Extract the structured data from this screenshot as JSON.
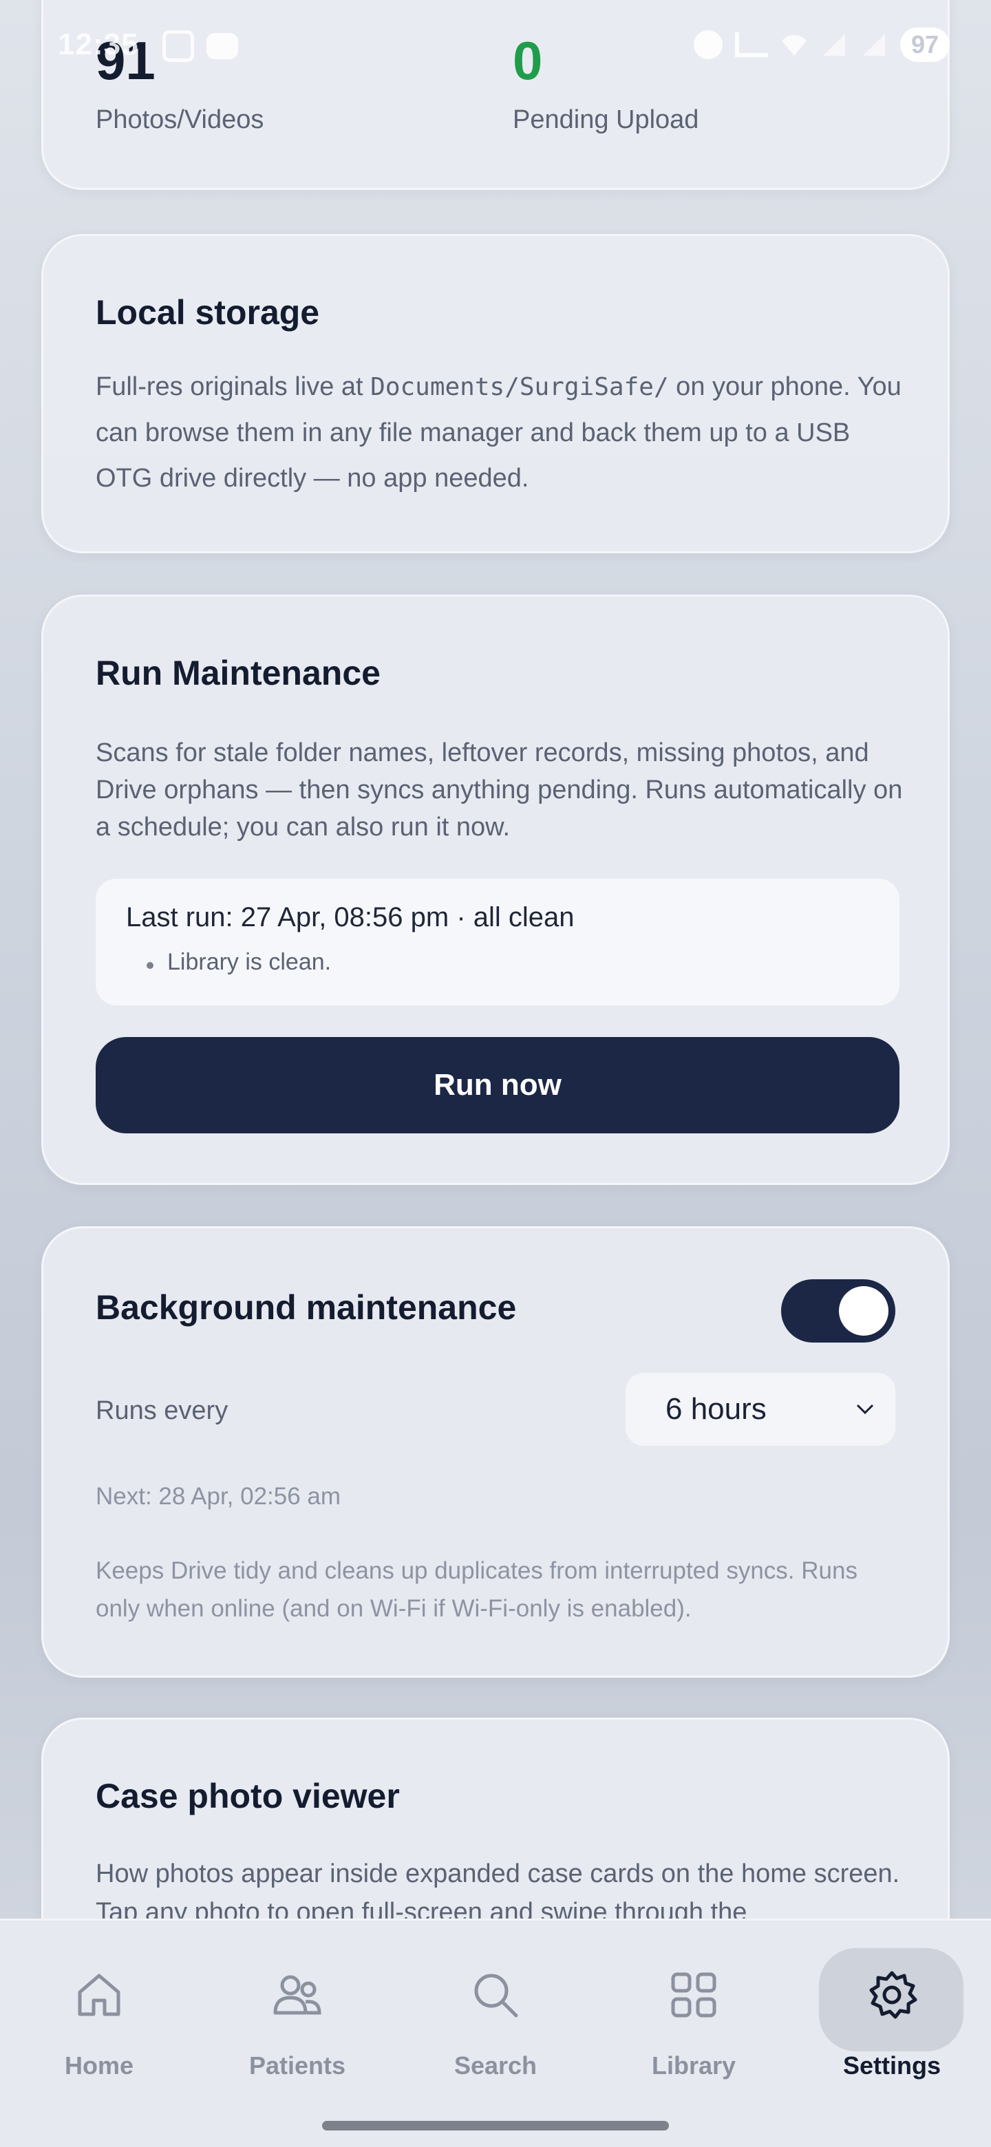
{
  "status_bar": {
    "time": "12:35",
    "battery": "97"
  },
  "stats": {
    "photos_count": "91",
    "photos_label": "Photos/Videos",
    "pending_count": "0",
    "pending_label": "Pending Upload",
    "pending_color": "#1f9d4a"
  },
  "local_storage": {
    "title": "Local storage",
    "text_before_path": "Full-res originals live at ",
    "path": "Documents/SurgiSafe/",
    "text_after_path": " on your phone. You can browse them in any file manager and back them up to a USB OTG drive directly — no app needed."
  },
  "maintenance": {
    "title": "Run Maintenance",
    "description": "Scans for stale folder names, leftover records, missing photos, and Drive orphans — then syncs anything pending. Runs automatically on a schedule; you can also run it now.",
    "last_run": "Last run: 27 Apr, 08:56 pm · all clean",
    "last_run_items": [
      "Library is clean."
    ],
    "run_button": "Run now"
  },
  "background": {
    "title": "Background maintenance",
    "toggle_on": true,
    "runs_every_label": "Runs every",
    "interval_value": "6 hours",
    "next_run": "Next: 28 Apr, 02:56 am",
    "note": "Keeps Drive tidy and cleans up duplicates from interrupted syncs. Runs only when online (and on Wi-Fi if Wi-Fi-only is enabled)."
  },
  "viewer": {
    "title": "Case photo viewer",
    "description": "How photos appear inside expanded case cards on the home screen. Tap any photo to open full-screen and swipe through the"
  },
  "nav": {
    "items": [
      {
        "label": "Home",
        "icon": "home-icon"
      },
      {
        "label": "Patients",
        "icon": "patients-icon"
      },
      {
        "label": "Search",
        "icon": "search-icon"
      },
      {
        "label": "Library",
        "icon": "library-icon"
      },
      {
        "label": "Settings",
        "icon": "settings-icon"
      }
    ],
    "active": "Settings"
  },
  "colors": {
    "accent": "#1b2745",
    "active_nav": "#141c30",
    "inactive_nav": "#8b919e"
  }
}
